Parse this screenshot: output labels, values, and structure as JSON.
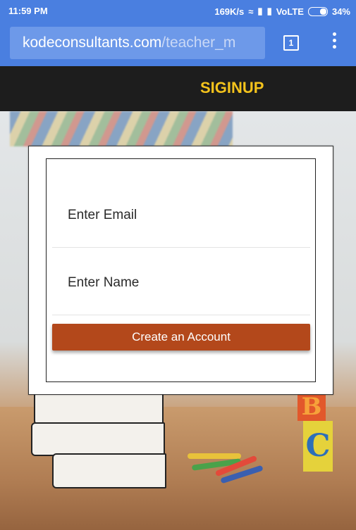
{
  "status_bar": {
    "time": "11:59 PM",
    "network_speed": "169K/s",
    "carrier": "VoLTE",
    "battery": "34%",
    "icons": [
      "wifi-icon",
      "signal-icon",
      "signal-icon",
      "battery-icon"
    ]
  },
  "browser": {
    "url_host": "kodeconsultants.com",
    "url_path": "/teacher_m",
    "tab_count": "1",
    "menu_icon": "more-vert-icon"
  },
  "header": {
    "title": "SIGINUP"
  },
  "form": {
    "email_placeholder": "Enter Email",
    "name_placeholder": "Enter Name",
    "submit_label": "Create an Account"
  },
  "colors": {
    "browser_bar": "#4a7fe0",
    "header_bg": "#1d1d1d",
    "title_color": "#f4c31c",
    "button_bg": "#b3481b"
  }
}
